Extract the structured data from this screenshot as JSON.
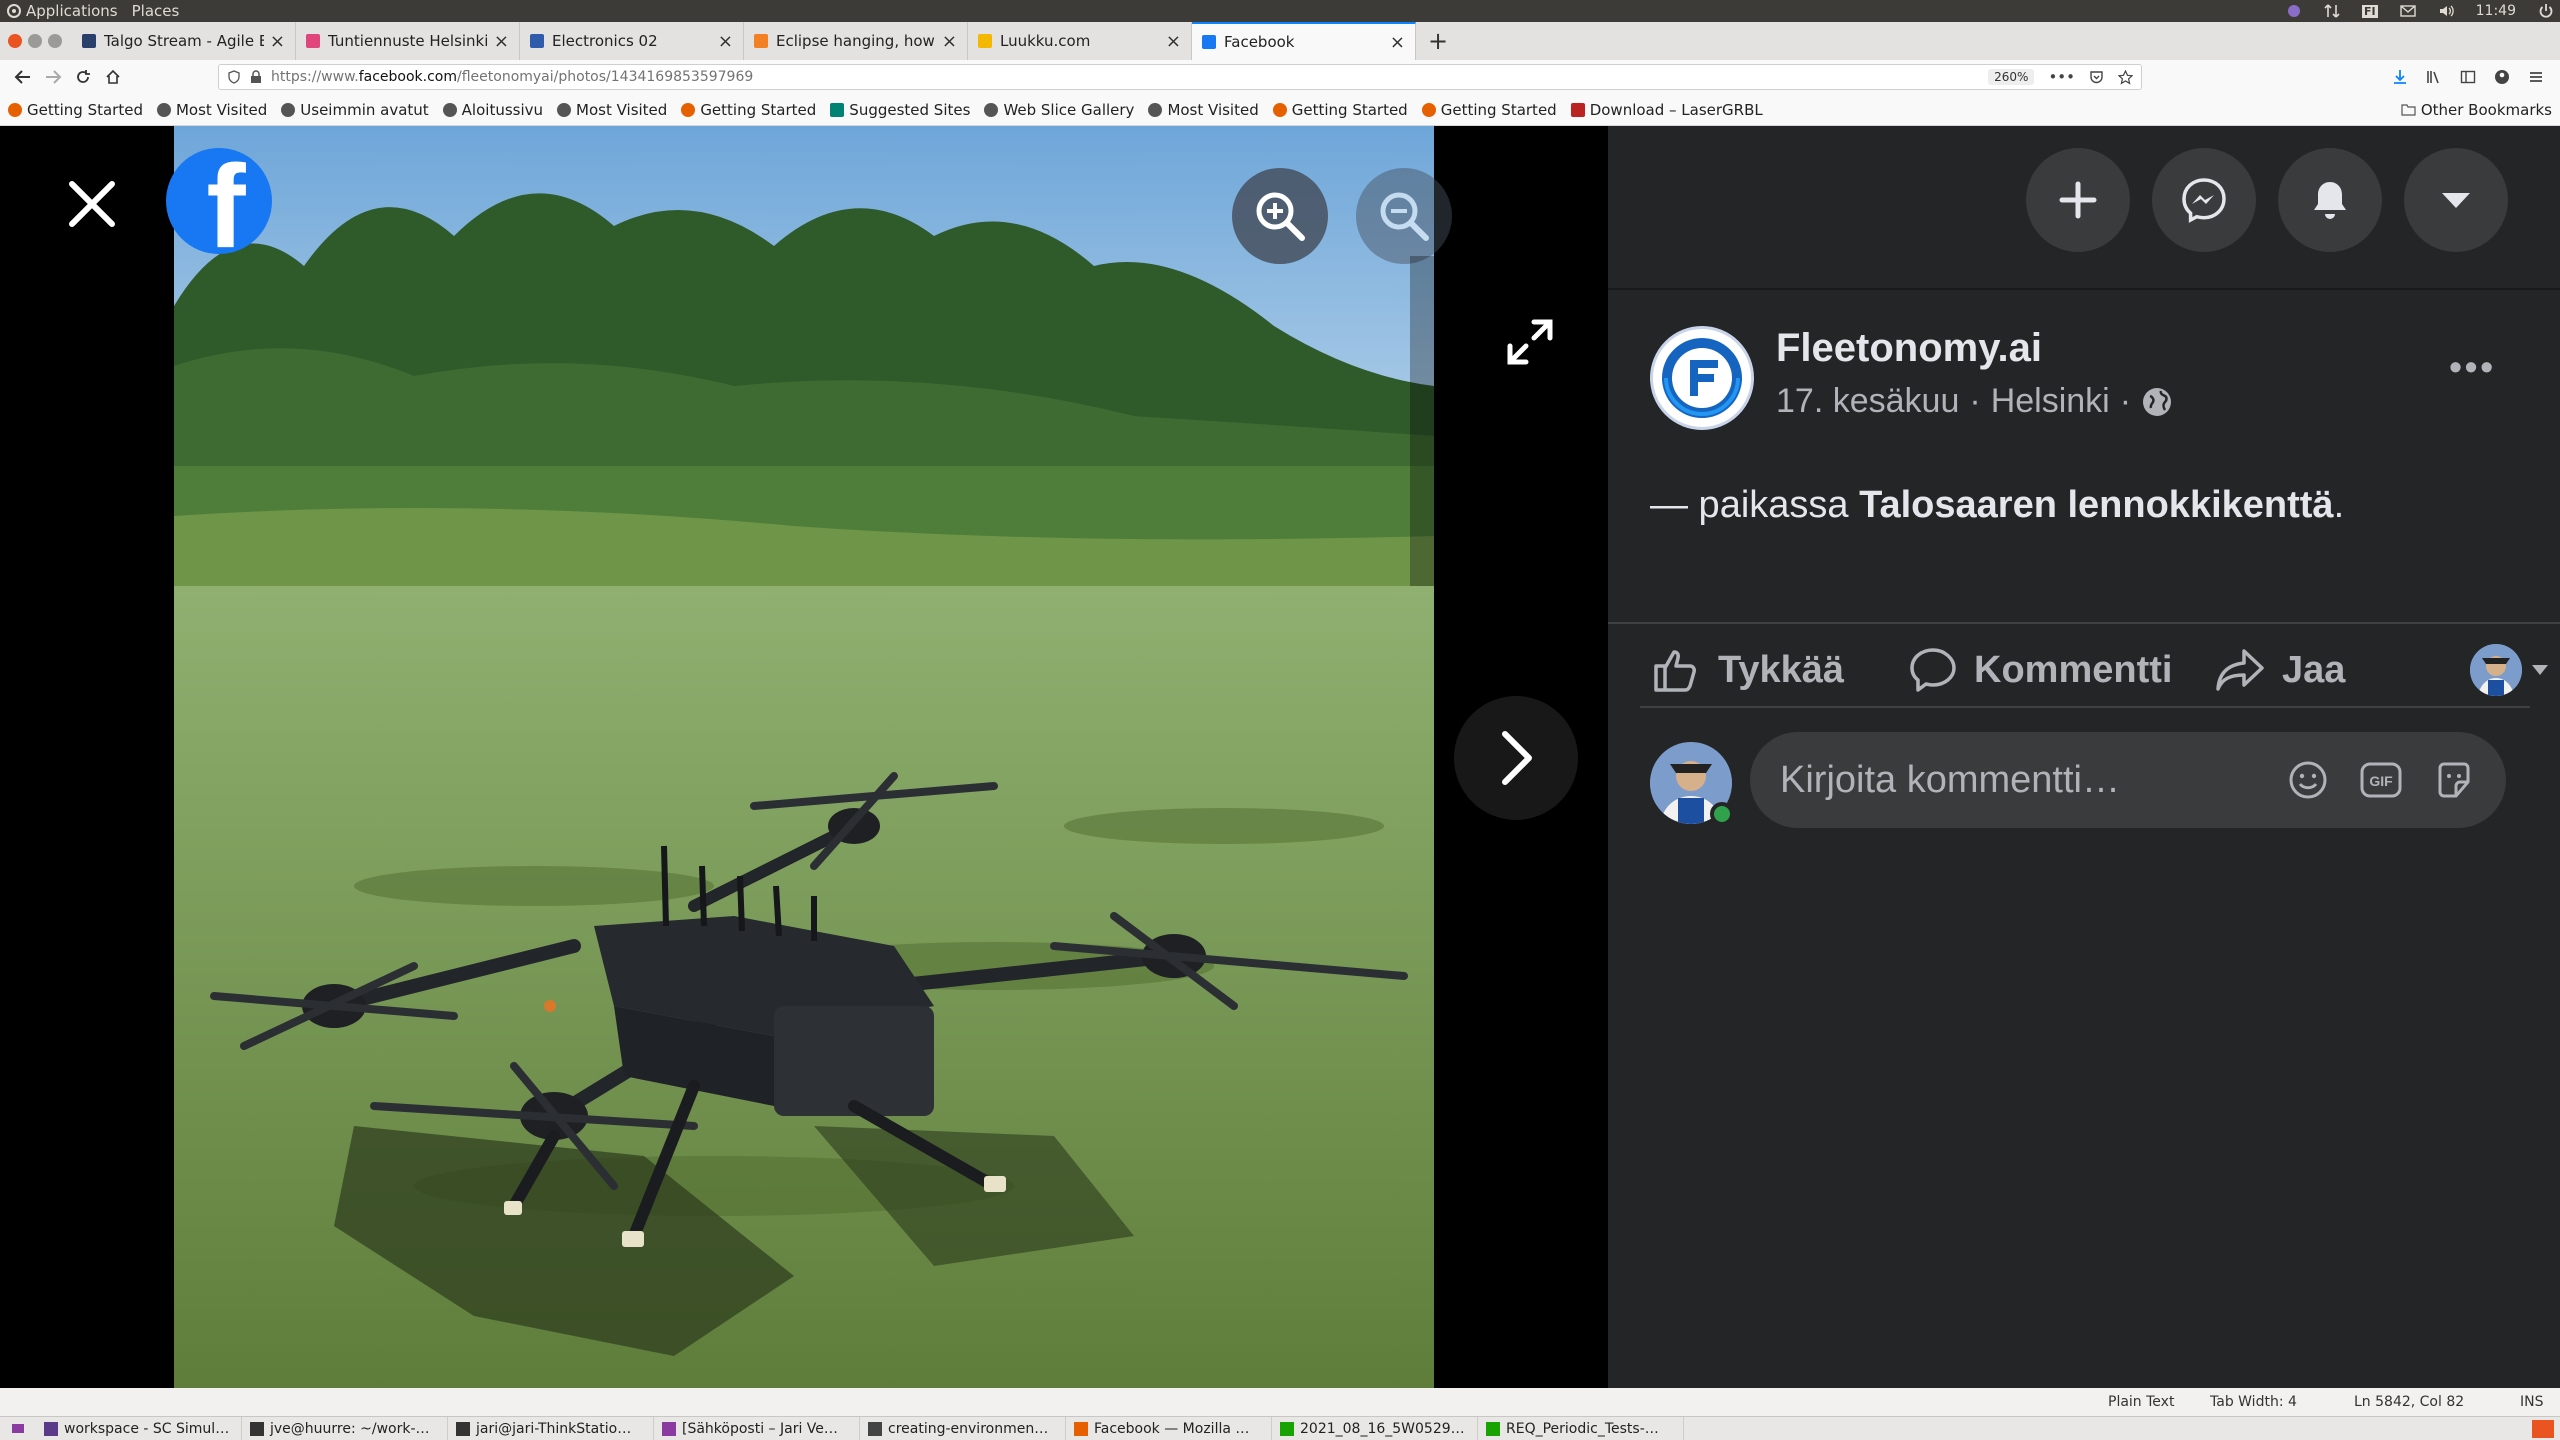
{
  "os_panel": {
    "applications": "Applications",
    "places": "Places",
    "keyboard_layout": "FI",
    "clock": "11:49"
  },
  "browser": {
    "tabs": [
      {
        "label": "Talgo Stream - Agile Bo",
        "favicon_color": "#2a3f6b",
        "active": false
      },
      {
        "label": "Tuntiennuste Helsinki -",
        "favicon_color": "#e0457b",
        "active": false
      },
      {
        "label": "Electronics 02",
        "favicon_color": "#2e5caa",
        "active": false
      },
      {
        "label": "Eclipse hanging, how to",
        "favicon_color": "#f48024",
        "active": false
      },
      {
        "label": "Luukku.com",
        "favicon_color": "#f5b800",
        "active": false
      },
      {
        "label": "Facebook",
        "favicon_color": "#1877f2",
        "active": true
      }
    ],
    "url_prefix": "https://www.",
    "url_domain": "facebook.com",
    "url_path": "/fleetonomyai/photos/1434169853597969",
    "zoom_level": "260%",
    "bookmarks": [
      {
        "label": "Getting Started",
        "icon": "firefox-icon"
      },
      {
        "label": "Most Visited",
        "icon": "gear-icon"
      },
      {
        "label": "Useimmin avatut",
        "icon": "gear-icon"
      },
      {
        "label": "Aloitussivu",
        "icon": "globe-icon"
      },
      {
        "label": "Most Visited",
        "icon": "gear-icon"
      },
      {
        "label": "Getting Started",
        "icon": "firefox-icon"
      },
      {
        "label": "Suggested Sites",
        "icon": "bing-icon"
      },
      {
        "label": "Web Slice Gallery",
        "icon": "globe-icon"
      },
      {
        "label": "Most Visited",
        "icon": "gear-icon"
      },
      {
        "label": "Getting Started",
        "icon": "firefox-icon"
      },
      {
        "label": "Getting Started",
        "icon": "firefox-icon"
      },
      {
        "label": "Download – LaserGRBL",
        "icon": "laser-icon"
      }
    ],
    "other_bookmarks": "Other Bookmarks"
  },
  "post": {
    "page_name": "Fleetonomy.ai",
    "date": "17. kesäkuu",
    "location": "Helsinki",
    "separator": "·",
    "caption_prefix": "— paikassa ",
    "caption_place": "Talosaaren lennokkikenttä",
    "caption_suffix": ".",
    "like_label": "Tykkää",
    "comment_label": "Kommentti",
    "share_label": "Jaa",
    "comment_placeholder": "Kirjoita kommentti…",
    "more": "•••"
  },
  "editor_status": {
    "language": "Plain Text",
    "tab_width": "Tab Width: 4",
    "position": "Ln 5842, Col 82",
    "mode": "INS"
  },
  "taskbar": [
    {
      "label": "workspace - SC Simul…",
      "icon_color": "#5b3a8a"
    },
    {
      "label": "jve@huurre: ~/work-…",
      "icon_color": "#333333"
    },
    {
      "label": "jari@jari-ThinkStatio…",
      "icon_color": "#333333"
    },
    {
      "label": "[Sähköposti – Jari Ve…",
      "icon_color": "#8a3aa0"
    },
    {
      "label": "creating-environmen…",
      "icon_color": "#444444"
    },
    {
      "label": "Facebook — Mozilla …",
      "icon_color": "#e66000"
    },
    {
      "label": "2021_08_16_5W0529…",
      "icon_color": "#18a303"
    },
    {
      "label": "REQ_Periodic_Tests-…",
      "icon_color": "#18a303"
    }
  ]
}
